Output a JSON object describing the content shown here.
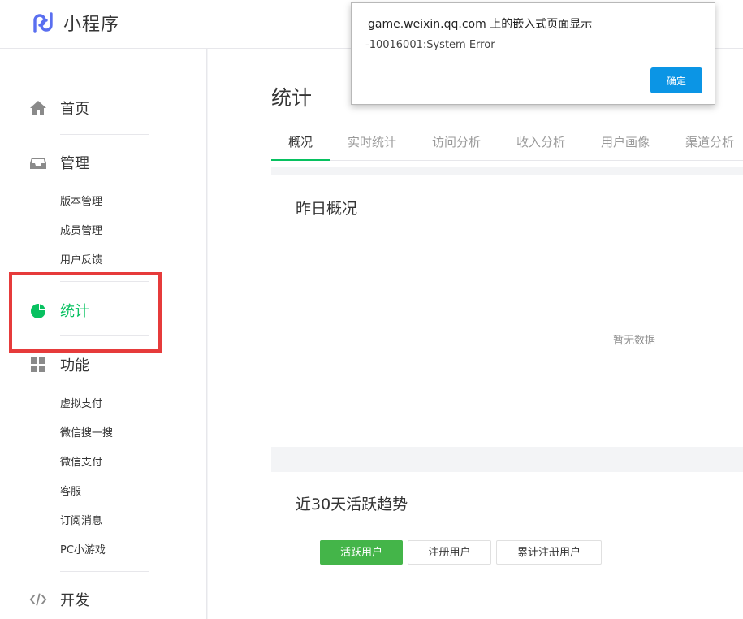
{
  "brand": {
    "name": "小程序",
    "logo_icon": "miniprogram-logo-icon",
    "accent": "#5a6ff0"
  },
  "sidebar": {
    "groups": [
      {
        "label": "首页",
        "icon": "home-icon"
      },
      {
        "label": "管理",
        "icon": "inbox-icon",
        "items": [
          "版本管理",
          "成员管理",
          "用户反馈"
        ]
      },
      {
        "label": "统计",
        "icon": "pie-chart-icon",
        "active": true
      },
      {
        "label": "功能",
        "icon": "grid-icon",
        "items": [
          "虚拟支付",
          "微信搜一搜",
          "微信支付",
          "客服",
          "订阅消息",
          "PC小游戏"
        ]
      },
      {
        "label": "开发",
        "icon": "code-icon"
      }
    ],
    "active_color": "#07c160",
    "highlight_color": "#e63b3b"
  },
  "main": {
    "title": "统计",
    "tabs": [
      "概况",
      "实时统计",
      "访问分析",
      "收入分析",
      "用户画像",
      "渠道分析"
    ],
    "active_tab": "概况",
    "overview_card": {
      "title": "昨日概况",
      "empty_text": "暂无数据"
    },
    "trend_card": {
      "title": "近30天活跃趋势",
      "buttons": [
        "活跃用户",
        "注册用户",
        "累计注册用户"
      ],
      "active_button": "活跃用户"
    }
  },
  "dialog": {
    "title": "game.weixin.qq.com 上的嵌入式页面显示",
    "message": "-10016001:System Error",
    "ok_label": "确定",
    "ok_color": "#0b95e5"
  }
}
